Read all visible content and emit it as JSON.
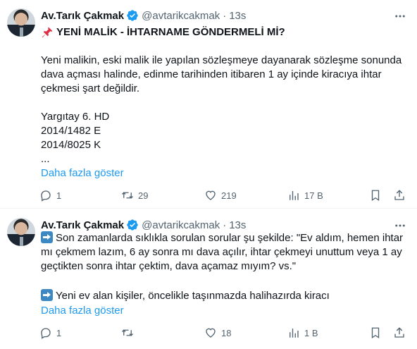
{
  "tweets": [
    {
      "author": {
        "name": "Av.Tarık Çakmak",
        "handle": "@avtarikcakmak",
        "time": "13s"
      },
      "title": "YENİ MALİK - İHTARNAME GÖNDERMELİ Mİ?",
      "paragraph": "Yeni malikin, eski malik ile yapılan sözleşmeye dayanarak sözleşme sonunda dava açması halinde, edinme tarihinden itibaren 1 ay içinde kiracıya ihtar çekmesi şart değildir.",
      "reference_lines": [
        "Yargıtay 6. HD",
        "2014/1482 E",
        "2014/8025 K"
      ],
      "ellipsis": "...",
      "show_more": "Daha fazla göster",
      "stats": {
        "replies": "1",
        "retweets": "29",
        "likes": "219",
        "views": "17 B"
      }
    },
    {
      "author": {
        "name": "Av.Tarık Çakmak",
        "handle": "@avtarikcakmak",
        "time": "13s"
      },
      "paragraph1": "Son zamanlarda sıklıkla sorulan sorular şu şekilde: \"Ev aldım, hemen ihtar mı çekmem lazım, 6 ay sonra mı dava açılır, ihtar çekmeyi unuttum veya 1 ay geçtikten sonra ihtar çektim, dava açamaz mıyım? vs.\"",
      "paragraph2": "Yeni ev alan kişiler, öncelikle taşınmazda halihazırda kiracı",
      "show_more": "Daha fazla göster",
      "stats": {
        "replies": "1",
        "retweets": "",
        "likes": "18",
        "views": "1 B"
      }
    }
  ],
  "colors": {
    "accent": "#1d9bf0",
    "text": "#0f1419",
    "muted": "#536471",
    "verified": "#1d9bf0",
    "divider": "#eff3f4"
  }
}
